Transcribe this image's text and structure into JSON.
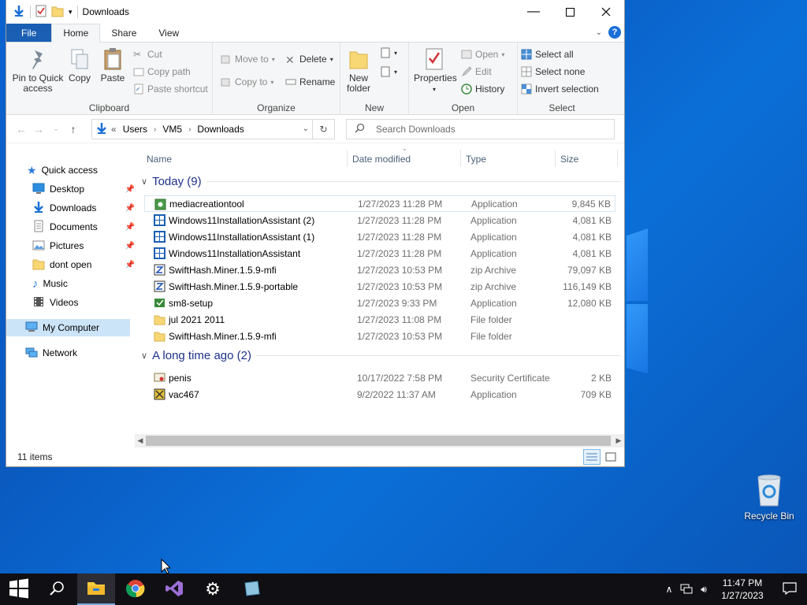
{
  "window": {
    "title": "Downloads",
    "controls": [
      "minimize",
      "maximize",
      "close"
    ]
  },
  "ribbon_tabs": {
    "file": "File",
    "home": "Home",
    "share": "Share",
    "view": "View"
  },
  "ribbon": {
    "clipboard": {
      "label": "Clipboard",
      "pin": "Pin to Quick access",
      "copy": "Copy",
      "paste": "Paste",
      "cut": "Cut",
      "copy_path": "Copy path",
      "paste_shortcut": "Paste shortcut"
    },
    "organize": {
      "label": "Organize",
      "move_to": "Move to",
      "copy_to": "Copy to",
      "delete": "Delete",
      "rename": "Rename"
    },
    "new": {
      "label": "New",
      "new_folder": "New folder"
    },
    "open": {
      "label": "Open",
      "properties": "Properties",
      "open": "Open",
      "edit": "Edit",
      "history": "History"
    },
    "select": {
      "label": "Select",
      "select_all": "Select all",
      "select_none": "Select none",
      "invert": "Invert selection"
    }
  },
  "address": {
    "prefix": "«",
    "crumbs": [
      "Users",
      "VM5",
      "Downloads"
    ],
    "search_placeholder": "Search Downloads"
  },
  "nav": {
    "quick_access": "Quick access",
    "items": [
      "Desktop",
      "Downloads",
      "Documents",
      "Pictures",
      "dont open",
      "Music",
      "Videos"
    ],
    "my_computer": "My Computer",
    "network": "Network"
  },
  "columns": {
    "name": "Name",
    "date": "Date modified",
    "type": "Type",
    "size": "Size"
  },
  "groups": {
    "today": "Today (9)",
    "long_ago": "A long time ago (2)"
  },
  "files_today": [
    {
      "name": "mediacreationtool",
      "date": "1/27/2023 11:28 PM",
      "type": "Application",
      "size": "9,845 KB",
      "icon": "setup-icon"
    },
    {
      "name": "Windows11InstallationAssistant (2)",
      "date": "1/27/2023 11:28 PM",
      "type": "Application",
      "size": "4,081 KB",
      "icon": "windows-icon"
    },
    {
      "name": "Windows11InstallationAssistant (1)",
      "date": "1/27/2023 11:28 PM",
      "type": "Application",
      "size": "4,081 KB",
      "icon": "windows-icon"
    },
    {
      "name": "Windows11InstallationAssistant",
      "date": "1/27/2023 11:28 PM",
      "type": "Application",
      "size": "4,081 KB",
      "icon": "windows-icon"
    },
    {
      "name": "SwiftHash.Miner.1.5.9-mfi",
      "date": "1/27/2023 10:53 PM",
      "type": "zip Archive",
      "size": "79,097 KB",
      "icon": "zip-icon"
    },
    {
      "name": "SwiftHash.Miner.1.5.9-portable",
      "date": "1/27/2023 10:53 PM",
      "type": "zip Archive",
      "size": "116,149 KB",
      "icon": "zip-icon"
    },
    {
      "name": "sm8-setup",
      "date": "1/27/2023 9:33 PM",
      "type": "Application",
      "size": "12,080 KB",
      "icon": "installer-icon"
    },
    {
      "name": "jul 2021 2011",
      "date": "1/27/2023 11:08 PM",
      "type": "File folder",
      "size": "",
      "icon": "folder-icon"
    },
    {
      "name": "SwiftHash.Miner.1.5.9-mfi",
      "date": "1/27/2023 10:53 PM",
      "type": "File folder",
      "size": "",
      "icon": "folder-icon"
    }
  ],
  "files_old": [
    {
      "name": "penis",
      "date": "10/17/2022 7:58 PM",
      "type": "Security Certificate",
      "size": "2 KB",
      "icon": "certificate-icon"
    },
    {
      "name": "vac467",
      "date": "9/2/2022 11:37 AM",
      "type": "Application",
      "size": "709 KB",
      "icon": "app-icon"
    }
  ],
  "status": {
    "items": "11 items"
  },
  "desktop": {
    "recycle_bin": "Recycle Bin"
  },
  "taskbar": {
    "time": "11:47 PM",
    "date": "1/27/2023"
  }
}
